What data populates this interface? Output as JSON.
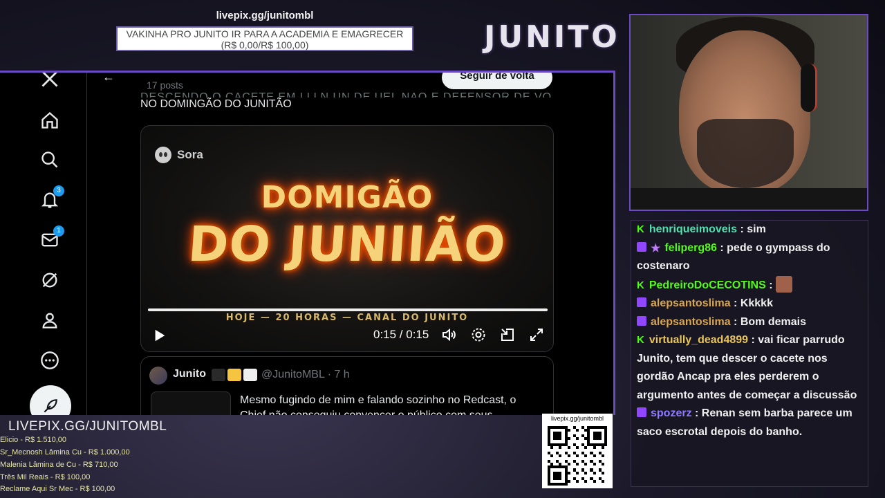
{
  "overlay": {
    "top_url": "livepix.gg/junitombl",
    "goal_line1": "VAKINHA PRO JUNITO IR PARA A ACADEMIA E EMAGRECER",
    "goal_line2": "(R$ 0,00/R$ 100,00)",
    "brand": "JUNITO",
    "bottom_url": "LIVEPIX.GG/JUNITOMBL",
    "qr_label": "livepix.gg/junitombl",
    "donors": [
      "Elicio - R$ 1.510,00",
      "Sr_Mecnosh Lâmina Cu - R$ 1.000,00",
      "Malenia Lâmina de Cu - R$ 710,00",
      "Três Mil Reais - R$ 100,00",
      "Reclame Aqui Sr Mec - R$ 100,00"
    ]
  },
  "twitter": {
    "nav_icons": [
      "x-logo-icon",
      "home-icon",
      "search-icon",
      "notifications-icon",
      "messages-icon",
      "grok-icon",
      "profile-icon",
      "more-icon",
      "compose-icon"
    ],
    "notif_count": "3",
    "msg_count": "1",
    "header": {
      "back": "←",
      "posts_count": "17 posts",
      "follow_back": "Seguir de volta"
    },
    "tweet": {
      "text_cut": "DESCENDO O CACETE EM LLLN UN DE UEL NAO E DEFENSOR DE VO",
      "text": "NO DOMINGÃO DO JUNITÃO"
    },
    "video": {
      "badge": "Sora",
      "title_line1": "DOMIGÃO",
      "title_line2": "DO JUNIIÃO",
      "subtitle": "HOJE — 20 HORAS — CANAL DO JUNITO",
      "time": "0:15 / 0:15",
      "progress": 1.0
    },
    "tweet2": {
      "name": "Junito",
      "handle": "@JunitoMBL · 7 h",
      "text": "Mesmo fugindo de mim e falando sozinho no Redcast, o Chief não conseguiu convencer o público com seus"
    }
  },
  "chat": [
    {
      "badges": [
        "kick"
      ],
      "user": "henriqueimoveis",
      "color": "#4fe0b0",
      "text": "sim"
    },
    {
      "badges": [
        "twitch",
        "star"
      ],
      "user": "feliperg86",
      "color": "#53fc18",
      "text": "pede o gympass do costenaro"
    },
    {
      "badges": [
        "kick"
      ],
      "user": "PedreiroDoCECOTINS",
      "color": "#53fc18",
      "text": "",
      "emote": true
    },
    {
      "badges": [
        "twitch"
      ],
      "user": "alepsantoslima",
      "color": "#d9a650",
      "text": "Kkkkk"
    },
    {
      "badges": [
        "twitch"
      ],
      "user": "alepsantoslima",
      "color": "#d9a650",
      "text": "Bom demais"
    },
    {
      "badges": [
        "kick"
      ],
      "user": "virtually_dead4899",
      "color": "#e8c45a",
      "text": "vai ficar parrudo Junito, tem que descer o cacete nos gordão Ancap pra eles perderem o argumento antes de começar a discussão"
    },
    {
      "badges": [
        "twitch"
      ],
      "user": "spozerz",
      "color": "#8f7bff",
      "text": "Renan sem barba parece um saco escrotal depois do banho."
    }
  ]
}
